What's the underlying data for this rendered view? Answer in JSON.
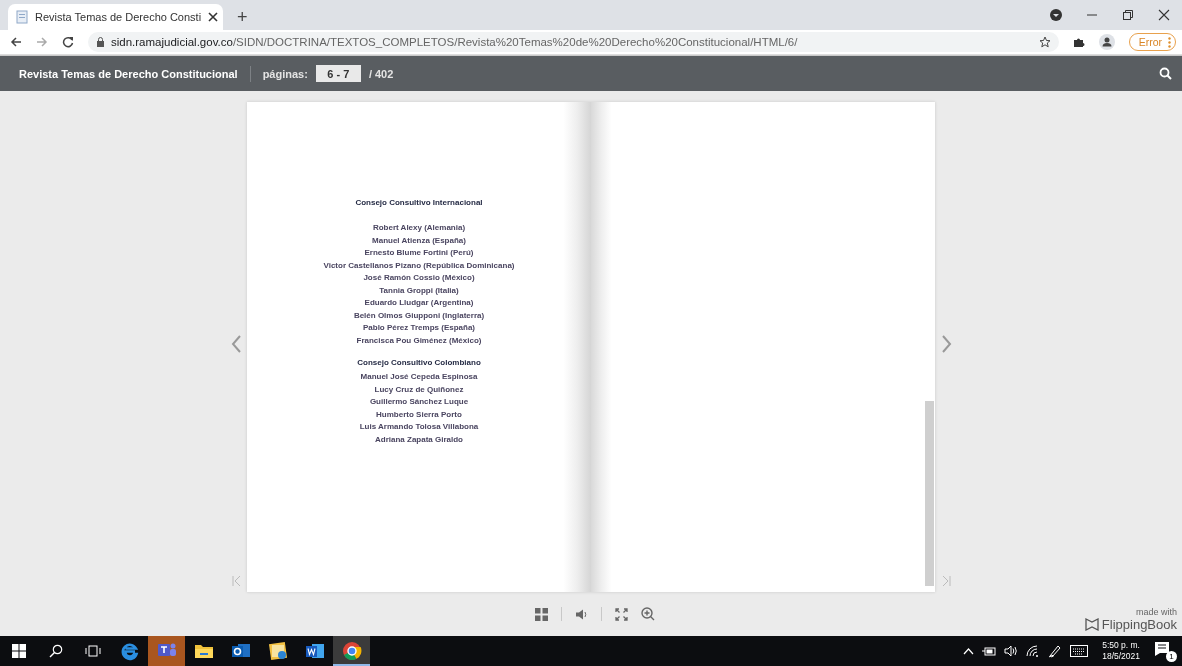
{
  "browser": {
    "tab": {
      "title": "Revista Temas de Derecho Consti"
    },
    "new_tab": "+",
    "url_host": "sidn.ramajudicial.gov.co",
    "url_path": "/SIDN/DOCTRINA/TEXTOS_COMPLETOS/Revista%20Temas%20de%20Derecho%20Constitucional/HTML/6/",
    "error_button": "Error"
  },
  "viewer": {
    "title": "Revista Temas de Derecho Constitucional",
    "pages_label": "páginas:",
    "pages_value": "6 - 7",
    "total": "/ 402"
  },
  "book": {
    "left_page": [
      {
        "heading": "Consejo  Consultivo Internacional",
        "names": [
          "Robert Alexy (Alemania)",
          "Manuel Atienza (España)",
          "Ernesto Blume Fortini (Perú)",
          "Victor Castellanos Pizano  (República Dominicana)",
          "José Ramón Cossio (México)",
          "Tannia Groppi (Italia)",
          "Eduardo Lludgar (Argentina)",
          "Belén Olmos Giupponi (Inglaterra)",
          "Pablo Pérez Tremps (España)",
          "Francisca Pou Giménez (México)"
        ]
      },
      {
        "heading": "Consejo Consultivo Colombiano",
        "names": [
          "Manuel José Cepeda Espinosa",
          "Lucy Cruz de Quiñonez",
          "Guillermo Sánchez Luque",
          "Humberto Sierra Porto",
          "Luis  Armando Tolosa Villabona",
          "Adriana Zapata Giraldo"
        ]
      }
    ]
  },
  "footer": {
    "made_with": "made with",
    "brand": "FlippingBook"
  },
  "taskbar": {
    "apps": [
      {
        "kind": "ie",
        "selected": false,
        "flashing": false
      },
      {
        "kind": "teams",
        "selected": false,
        "flashing": true
      },
      {
        "kind": "explorer",
        "selected": false,
        "flashing": false
      },
      {
        "kind": "outlook",
        "selected": false,
        "flashing": false
      },
      {
        "kind": "photos",
        "selected": false,
        "flashing": false
      },
      {
        "kind": "word",
        "selected": false,
        "flashing": false
      },
      {
        "kind": "chrome",
        "selected": true,
        "flashing": false
      }
    ],
    "time": "5:50 p. m.",
    "date": "18/5/2021",
    "notifications": "1"
  }
}
